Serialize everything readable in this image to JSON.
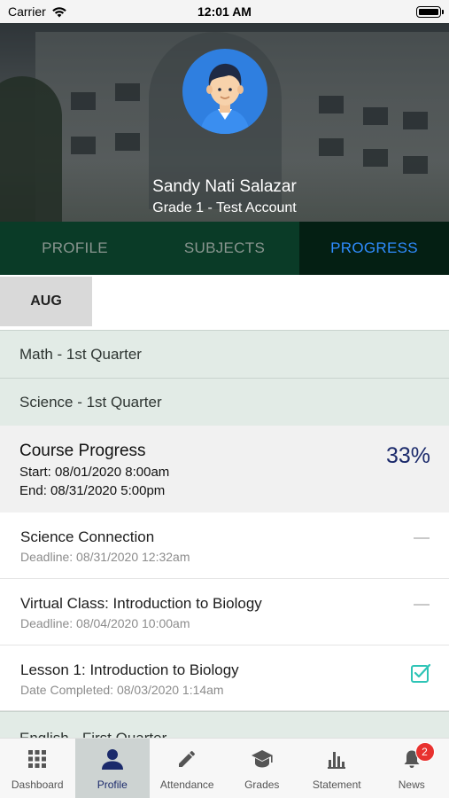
{
  "status_bar": {
    "carrier": "Carrier",
    "time": "12:01 AM"
  },
  "profile": {
    "name": "Sandy Nati Salazar",
    "subtitle": "Grade 1 - Test Account"
  },
  "tabs": [
    {
      "label": "PROFILE",
      "active": false
    },
    {
      "label": "SUBJECTS",
      "active": false
    },
    {
      "label": "PROGRESS",
      "active": true
    }
  ],
  "month": "AUG",
  "subjects": [
    {
      "label": "Math - 1st Quarter"
    },
    {
      "label": "Science - 1st Quarter"
    },
    {
      "label": "English - First Quarter"
    }
  ],
  "course_progress": {
    "title": "Course Progress",
    "start": "Start: 08/01/2020 8:00am",
    "end": "End: 08/31/2020 5:00pm",
    "percent": "33%"
  },
  "tasks": [
    {
      "title": "Science Connection",
      "sub": "Deadline: 08/31/2020 12:32am",
      "status_icon": "dash-icon"
    },
    {
      "title": "Virtual Class: Introduction to Biology",
      "sub": "Deadline: 08/04/2020 10:00am",
      "status_icon": "dash-icon"
    },
    {
      "title": "Lesson 1: Introduction to Biology",
      "sub": "Date Completed: 08/03/2020 1:14am",
      "status_icon": "checkbox-checked-icon"
    }
  ],
  "bottom_nav": [
    {
      "label": "Dashboard",
      "icon": "grid-icon",
      "active": false
    },
    {
      "label": "Profile",
      "icon": "person-icon",
      "active": true
    },
    {
      "label": "Attendance",
      "icon": "pencil-icon",
      "active": false
    },
    {
      "label": "Grades",
      "icon": "graduation-cap-icon",
      "active": false
    },
    {
      "label": "Statement",
      "icon": "bar-chart-icon",
      "active": false
    },
    {
      "label": "News",
      "icon": "bell-icon",
      "active": false,
      "badge": "2"
    }
  ],
  "colors": {
    "tab_bar": "#0a3b27",
    "tab_active_bg": "#041f13",
    "tab_active_text": "#2f8cff",
    "subject_bg": "#e2ebe6",
    "percent_text": "#1b2a6b",
    "check": "#2ec4b6",
    "badge": "#e8322f"
  }
}
